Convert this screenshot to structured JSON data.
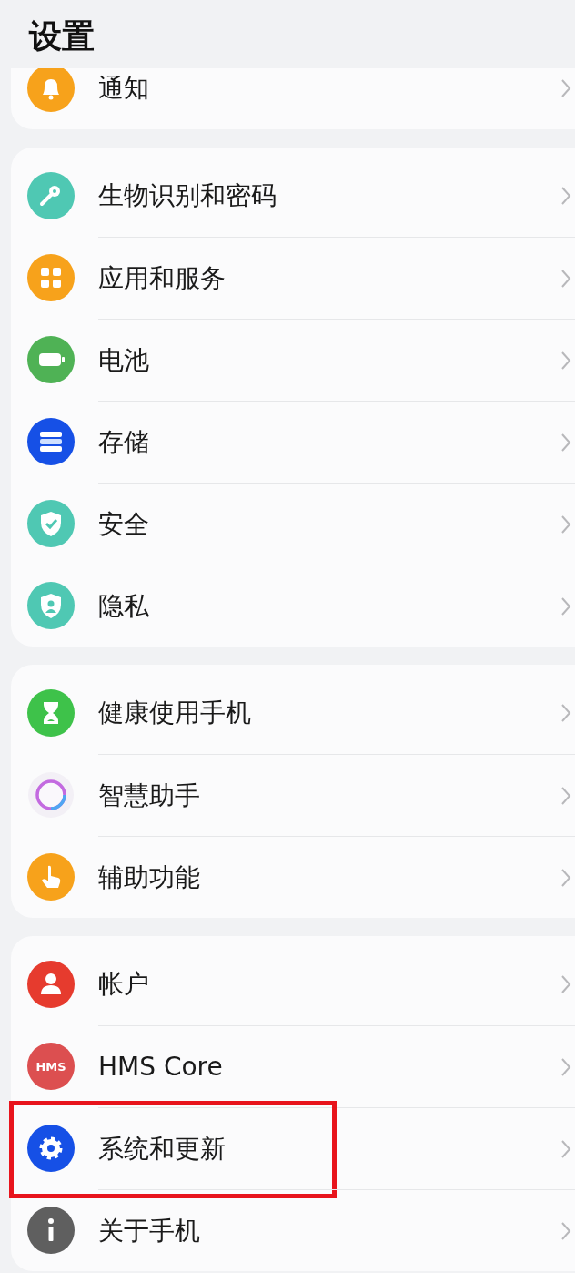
{
  "title": "设置",
  "groups": [
    {
      "items": [
        {
          "label": "通知",
          "kind": "bell",
          "highlighted": false
        }
      ]
    },
    {
      "items": [
        {
          "label": "生物识别和密码",
          "kind": "key",
          "highlighted": false
        },
        {
          "label": "应用和服务",
          "kind": "apps",
          "highlighted": false
        },
        {
          "label": "电池",
          "kind": "battery",
          "highlighted": false
        },
        {
          "label": "存储",
          "kind": "storage",
          "highlighted": false
        },
        {
          "label": "安全",
          "kind": "security",
          "highlighted": false
        },
        {
          "label": "隐私",
          "kind": "privacy",
          "highlighted": false
        }
      ]
    },
    {
      "items": [
        {
          "label": "健康使用手机",
          "kind": "hourglass",
          "highlighted": false
        },
        {
          "label": "智慧助手",
          "kind": "assistant",
          "highlighted": false
        },
        {
          "label": "辅助功能",
          "kind": "hand",
          "highlighted": false
        }
      ]
    },
    {
      "items": [
        {
          "label": "帐户",
          "kind": "account",
          "highlighted": false
        },
        {
          "label": "HMS Core",
          "kind": "hms",
          "icon_text": "HMS",
          "highlighted": false
        },
        {
          "label": "系统和更新",
          "kind": "gear",
          "highlighted": true
        },
        {
          "label": "关于手机",
          "kind": "info",
          "highlighted": false
        }
      ]
    }
  ]
}
